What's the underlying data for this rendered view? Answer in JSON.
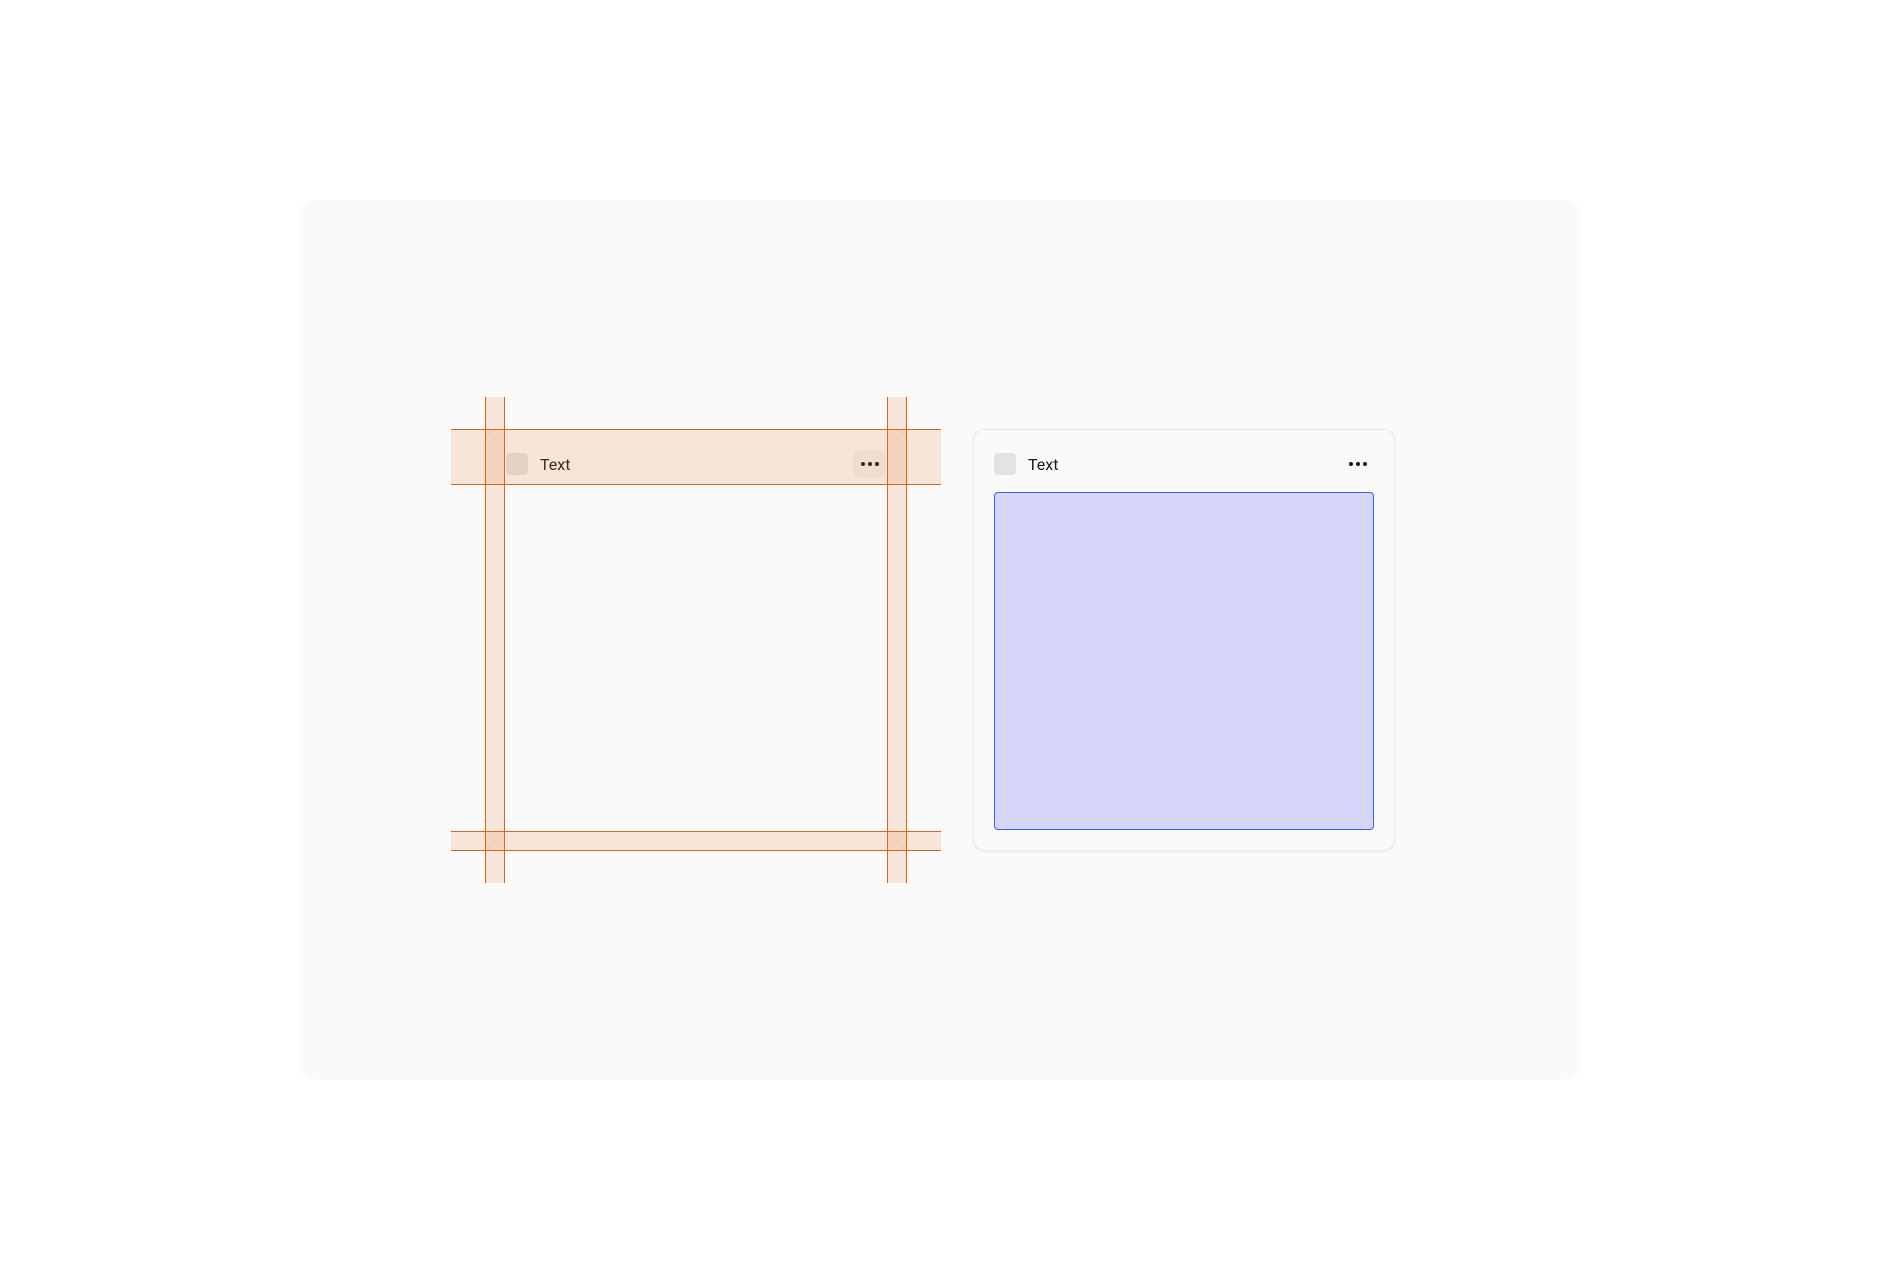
{
  "cards": [
    {
      "title": "Text",
      "state": "padding-inspect",
      "icon": "placeholder-icon"
    },
    {
      "title": "Text",
      "state": "body-selected",
      "icon": "placeholder-icon"
    }
  ],
  "colors": {
    "guide": "#d2691e",
    "guideFill": "rgba(234,117,43,0.15)",
    "selectionBorder": "#3b5bff",
    "selectionFill": "#d7d7fb"
  }
}
